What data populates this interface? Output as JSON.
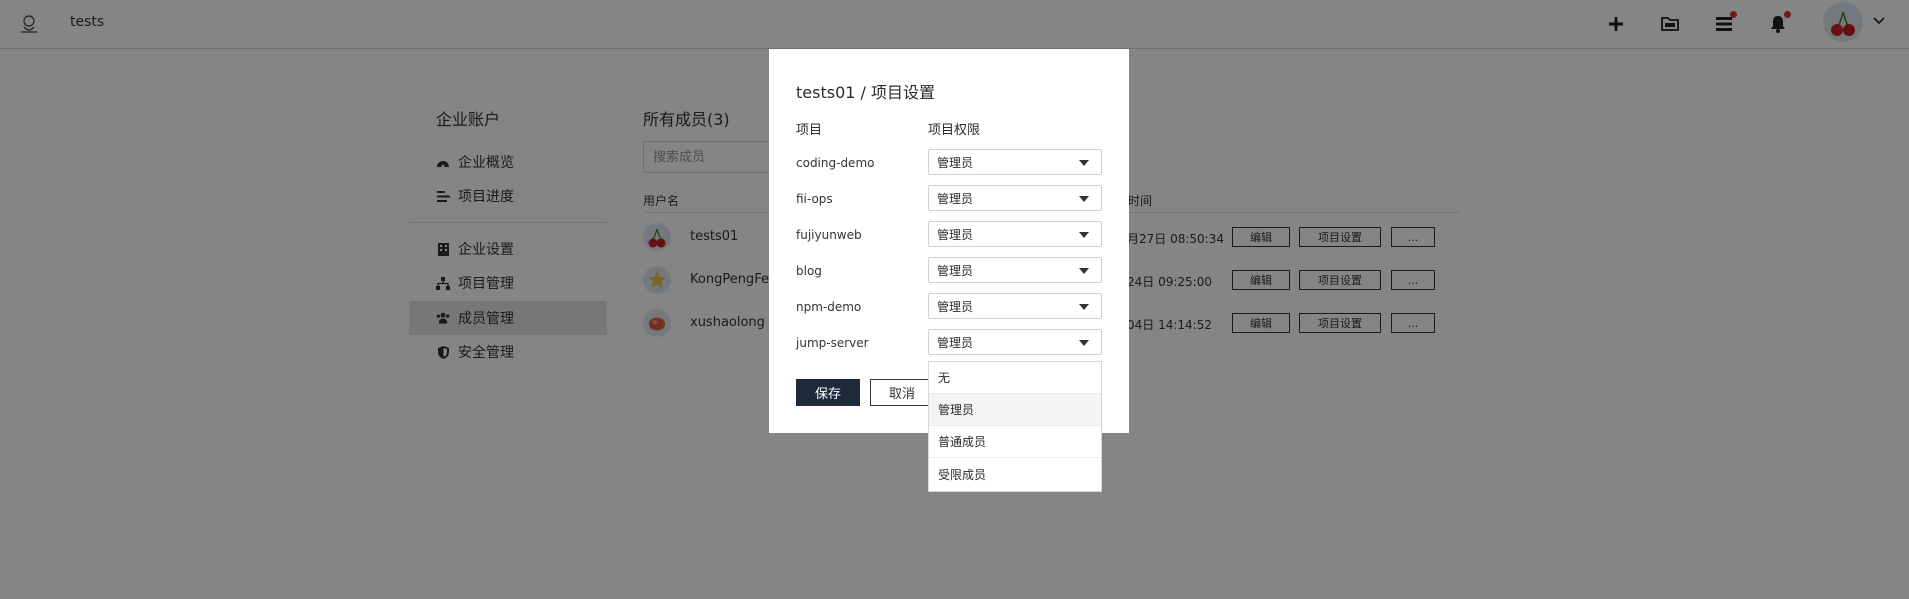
{
  "header": {
    "project_name": "tests",
    "icons": [
      "plus-icon",
      "folder-icon",
      "list-icon",
      "bell-icon"
    ],
    "avatar_alt": "user-avatar"
  },
  "sidebar": {
    "title": "企业账户",
    "items": [
      {
        "label": "企业概览",
        "icon": "dashboard-icon"
      },
      {
        "label": "项目进度",
        "icon": "progress-icon"
      },
      {
        "label": "企业设置",
        "icon": "building-icon"
      },
      {
        "label": "项目管理",
        "icon": "sitemap-icon"
      },
      {
        "label": "成员管理",
        "icon": "users-icon",
        "active": true
      },
      {
        "label": "安全管理",
        "icon": "shield-icon"
      }
    ]
  },
  "members": {
    "title": "所有成员(3)",
    "search_placeholder": "搜索成员",
    "col_user": "用户名",
    "col_time": "时间",
    "rows": [
      {
        "name": "tests01",
        "time": "月27日 08:50:34"
      },
      {
        "name": "KongPengFei",
        "time": "24日 09:25:00"
      },
      {
        "name": "xushaolong",
        "time": "04日 14:14:52"
      }
    ],
    "btn_edit": "编辑",
    "btn_project_settings": "项目设置",
    "btn_more": "..."
  },
  "dialog": {
    "title": "tests01 / 项目设置",
    "col_project": "项目",
    "col_permission": "项目权限",
    "rows": [
      {
        "project": "coding-demo",
        "permission": "管理员"
      },
      {
        "project": "fii-ops",
        "permission": "管理员"
      },
      {
        "project": "fujiyunweb",
        "permission": "管理员"
      },
      {
        "project": "blog",
        "permission": "管理员"
      },
      {
        "project": "npm-demo",
        "permission": "管理员"
      },
      {
        "project": "jump-server",
        "permission": "管理员"
      }
    ],
    "save_label": "保存",
    "cancel_label": "取消",
    "dropdown_options": [
      "无",
      "管理员",
      "普通成员",
      "受限成员"
    ],
    "highlighted_option": "管理员"
  },
  "colors": {
    "overlay": "rgba(0,0,0,0.48)",
    "primary_button": "#1e2a3b",
    "notification_dot": "#e0302a",
    "active_nav": "#e4e4e4"
  }
}
